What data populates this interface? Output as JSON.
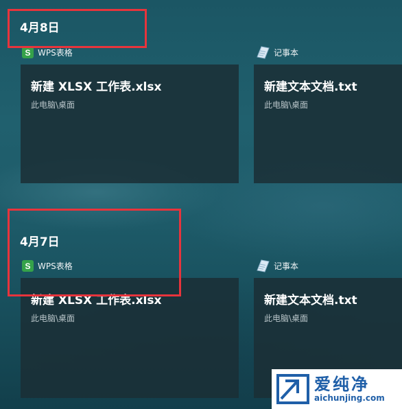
{
  "groups": [
    {
      "date": "4月8日",
      "items": [
        {
          "app": "WPS表格",
          "app_icon": "wps-spreadsheet-icon",
          "title": "新建 XLSX 工作表.xlsx",
          "path": "此电脑\\桌面"
        },
        {
          "app": "记事本",
          "app_icon": "notepad-icon",
          "title": "新建文本文档.txt",
          "path": "此电脑\\桌面"
        }
      ]
    },
    {
      "date": "4月7日",
      "items": [
        {
          "app": "WPS表格",
          "app_icon": "wps-spreadsheet-icon",
          "title": "新建 XLSX 工作表.xlsx",
          "path": "此电脑\\桌面"
        },
        {
          "app": "记事本",
          "app_icon": "notepad-icon",
          "title": "新建文本文档.txt",
          "path": "此电脑\\桌面"
        }
      ]
    }
  ],
  "watermark": {
    "brand": "爱纯净",
    "url": "aichunjing.com"
  },
  "colors": {
    "highlight_box": "#e8343c",
    "wps_green": "#35a24a",
    "card_bg": "#1b2f36",
    "watermark_blue": "#1f5fa8"
  }
}
